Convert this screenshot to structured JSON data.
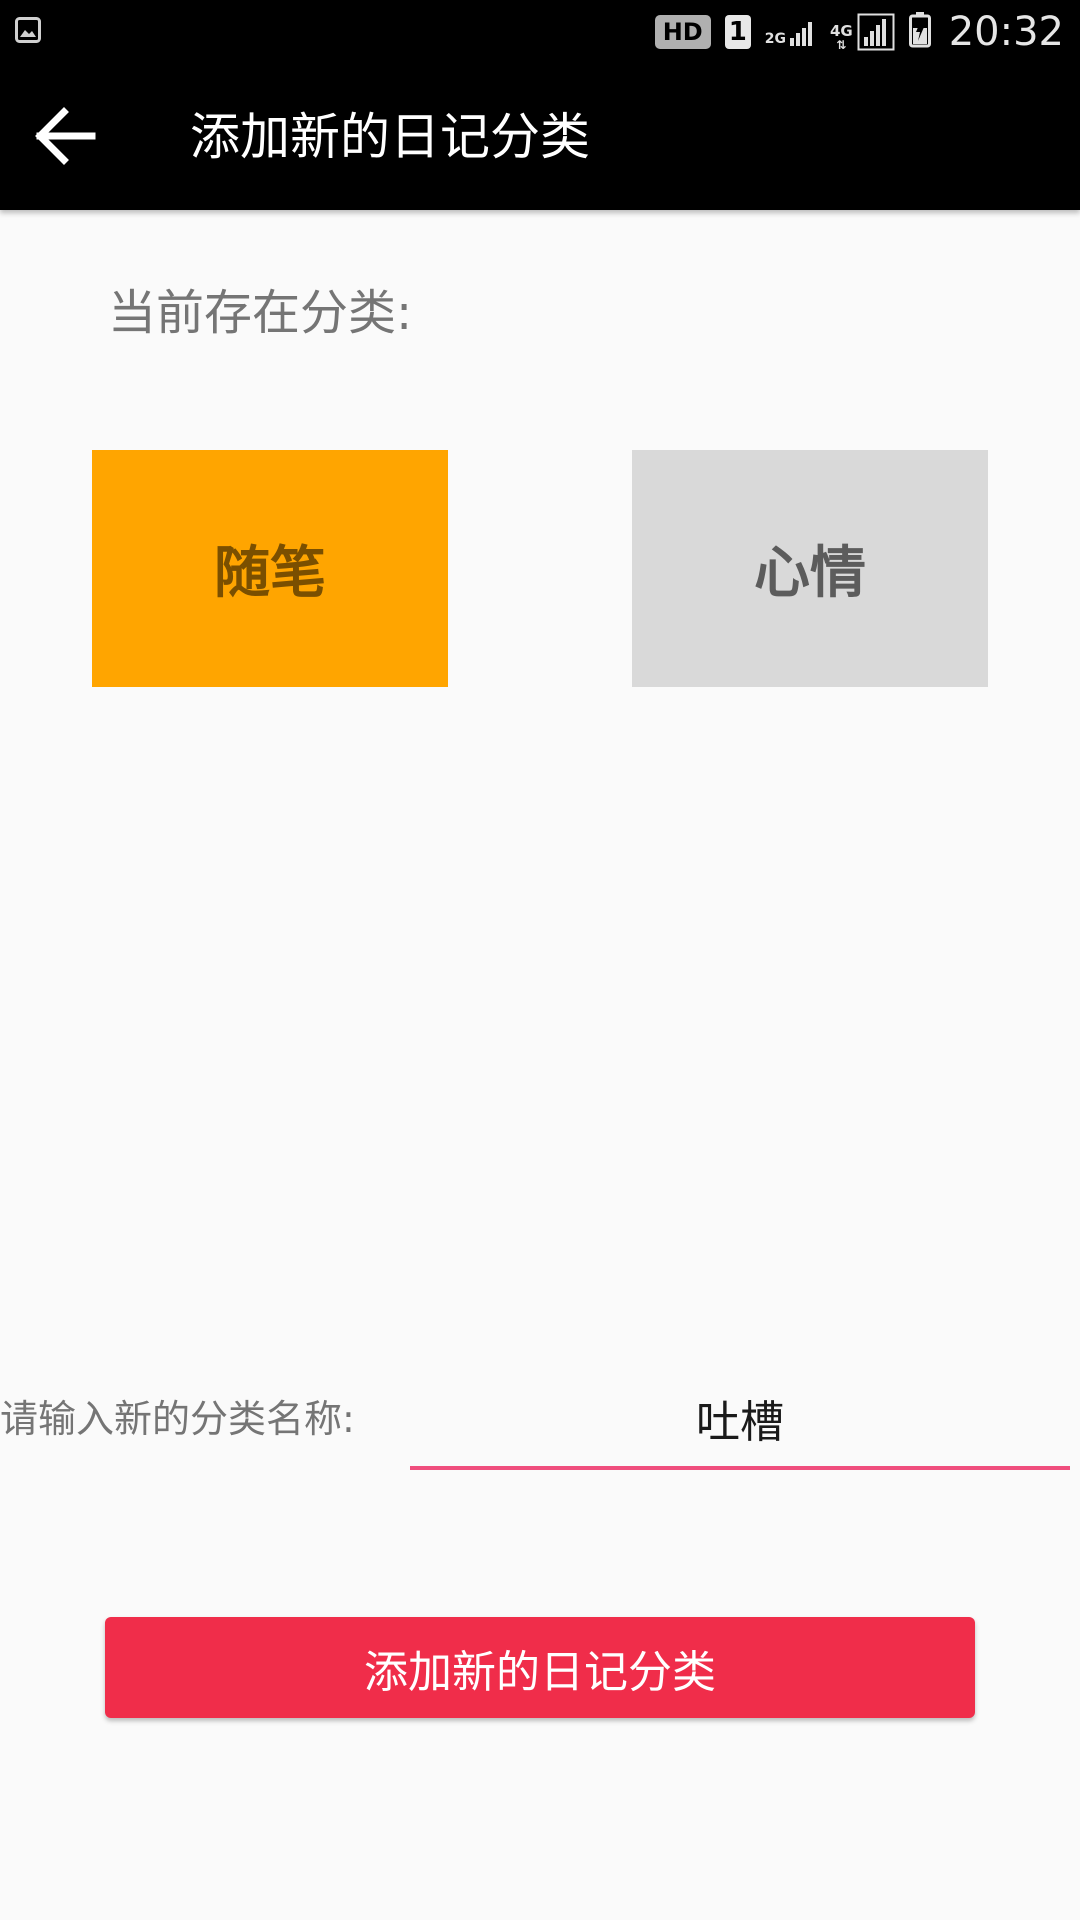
{
  "status_bar": {
    "left_icon": "gallery-notification-icon",
    "hd": "HD",
    "sim": "1",
    "network_2g": "2G",
    "network_4g": "4G",
    "time": "20:32",
    "icons": [
      "signal-2g-icon",
      "signal-4g-icon",
      "battery-charging-icon"
    ]
  },
  "header": {
    "back_icon": "arrow-left-icon",
    "title": "添加新的日记分类"
  },
  "existing": {
    "label": "当前存在分类:",
    "categories": [
      {
        "label": "随笔",
        "selected": true
      },
      {
        "label": "心情",
        "selected": false
      }
    ]
  },
  "form": {
    "label": "请输入新的分类名称:",
    "input_value": "吐槽"
  },
  "action": {
    "submit_label": "添加新的日记分类"
  },
  "colors": {
    "app_bar": "#000000",
    "selected_category": "#ffa500",
    "unselected_category": "#d9d9d9",
    "input_underline": "#ef4e7d",
    "button": "#f02d4a",
    "background": "#fafafa"
  }
}
